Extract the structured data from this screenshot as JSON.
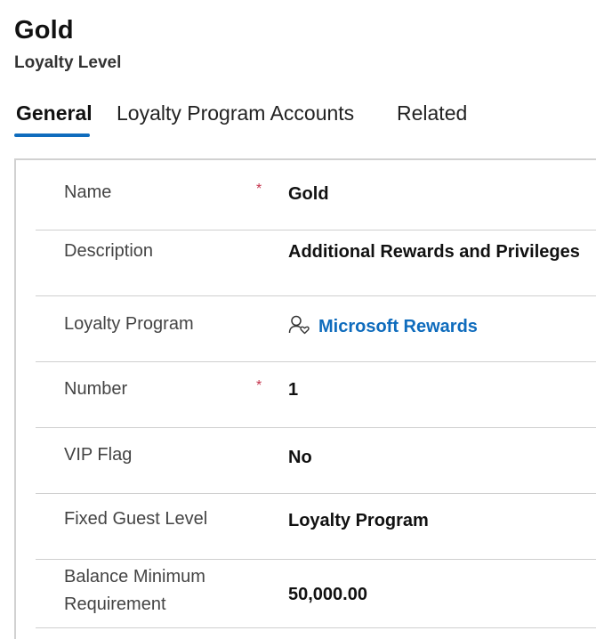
{
  "header": {
    "title": "Gold",
    "subtitle": "Loyalty Level"
  },
  "tabs": [
    {
      "label": "General",
      "active": true
    },
    {
      "label": "Loyalty Program Accounts",
      "active": false
    },
    {
      "label": "Related",
      "active": false
    }
  ],
  "fields": [
    {
      "label": "Name",
      "required": "*",
      "value": "Gold"
    },
    {
      "label": "Description",
      "required": "",
      "value": "Additional Rewards and Privileges"
    },
    {
      "label": "Loyalty Program",
      "required": "",
      "value": "Microsoft Rewards",
      "icon": "contact-heart-icon"
    },
    {
      "label": "Number",
      "required": "*",
      "value": "1"
    },
    {
      "label": "VIP Flag",
      "required": "",
      "value": "No"
    },
    {
      "label": "Fixed Guest Level",
      "required": "",
      "value": "Loyalty Program"
    },
    {
      "label_line1": "Balance Minimum",
      "label_line2": "Requirement",
      "required": "",
      "value": "50,000.00"
    }
  ],
  "colors": {
    "accent": "#0f6cbd",
    "required": "#c4314b"
  }
}
